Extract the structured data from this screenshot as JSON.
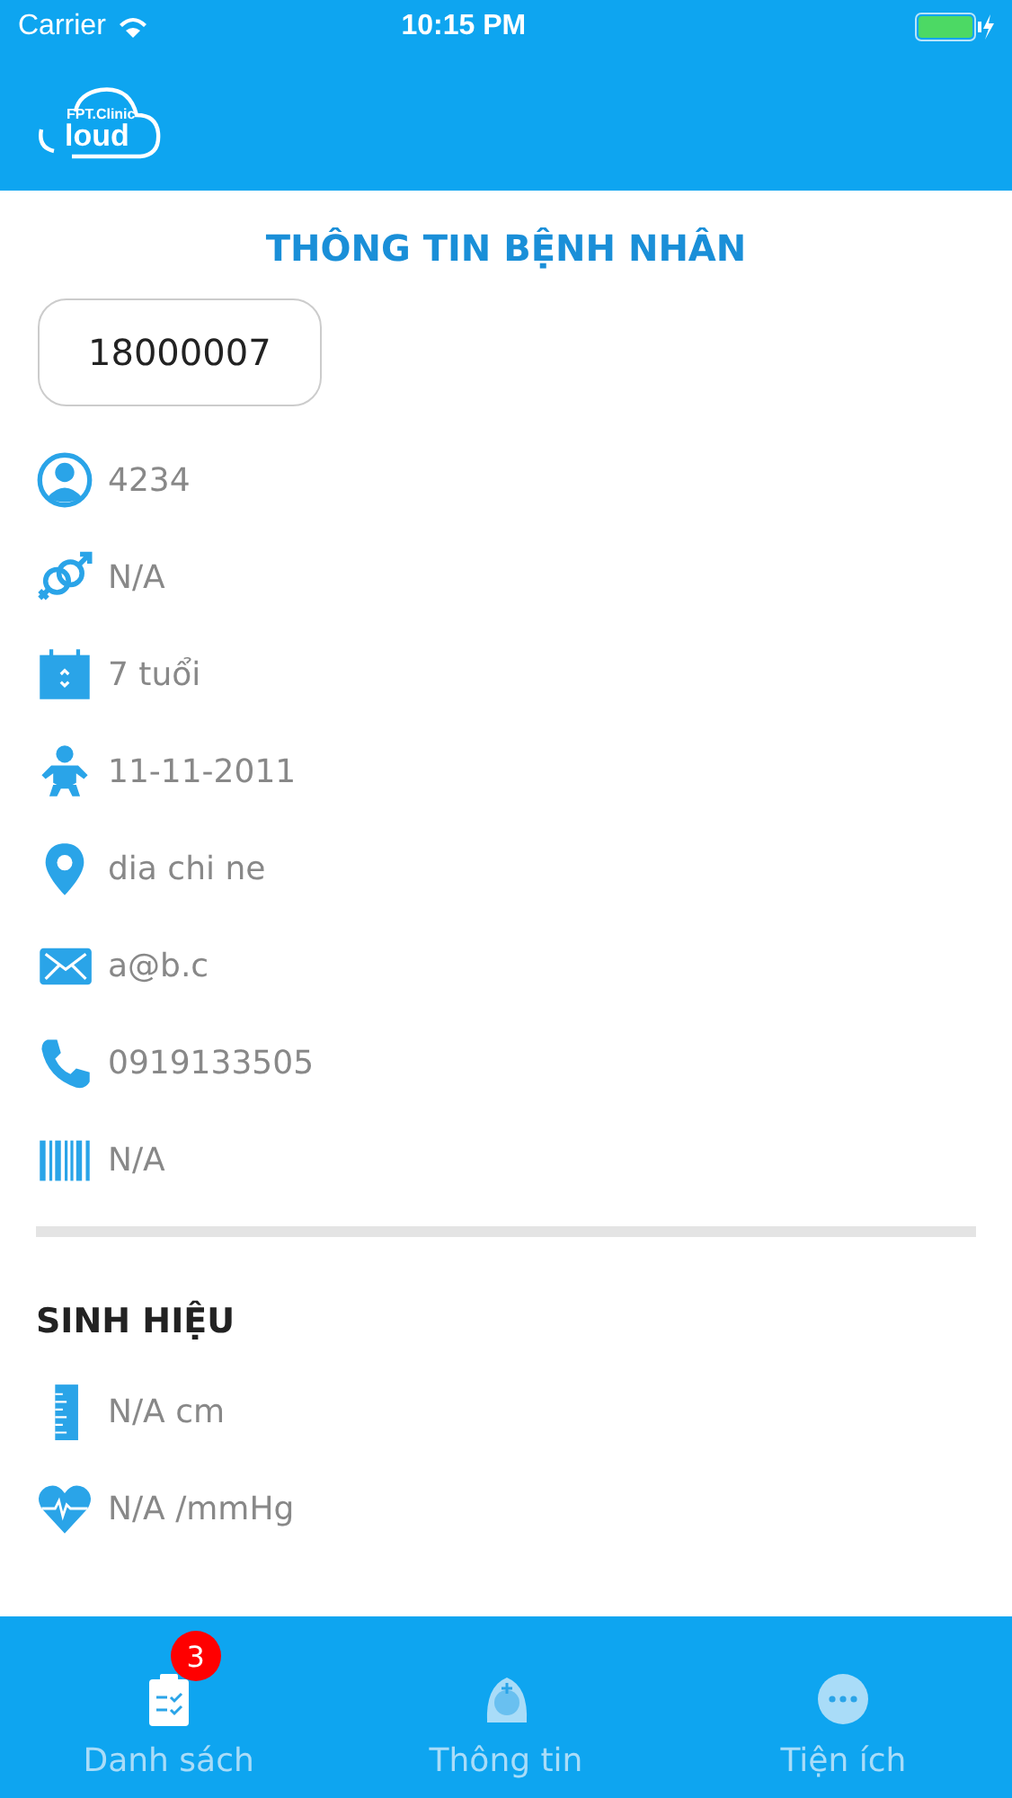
{
  "status_bar": {
    "carrier": "Carrier",
    "time": "10:15 PM"
  },
  "header": {
    "logo_top": "FPT.Clinic",
    "logo_bottom": "loud"
  },
  "title": "THÔNG TIN BỆNH NHÂN",
  "patient_id": "18000007",
  "info": [
    {
      "kind": "person",
      "value": "4234"
    },
    {
      "kind": "gender",
      "value": "N/A"
    },
    {
      "kind": "calendar",
      "value": "7 tuổi"
    },
    {
      "kind": "baby",
      "value": "11-11-2011"
    },
    {
      "kind": "pin",
      "value": "dia chi ne"
    },
    {
      "kind": "mail",
      "value": "a@b.c"
    },
    {
      "kind": "phone",
      "value": "0919133505"
    },
    {
      "kind": "barcode",
      "value": "N/A"
    }
  ],
  "vitals_title": "SINH HIỆU",
  "vitals": [
    {
      "kind": "ruler",
      "value": "N/A cm"
    },
    {
      "kind": "heart",
      "value": "N/A /mmHg"
    }
  ],
  "tabs": [
    {
      "kind": "list",
      "label": "Danh sách",
      "selected": true,
      "badge": "3"
    },
    {
      "kind": "nurse",
      "label": "Thông tin",
      "selected": false
    },
    {
      "kind": "more",
      "label": "Tiện ích",
      "selected": false
    }
  ]
}
